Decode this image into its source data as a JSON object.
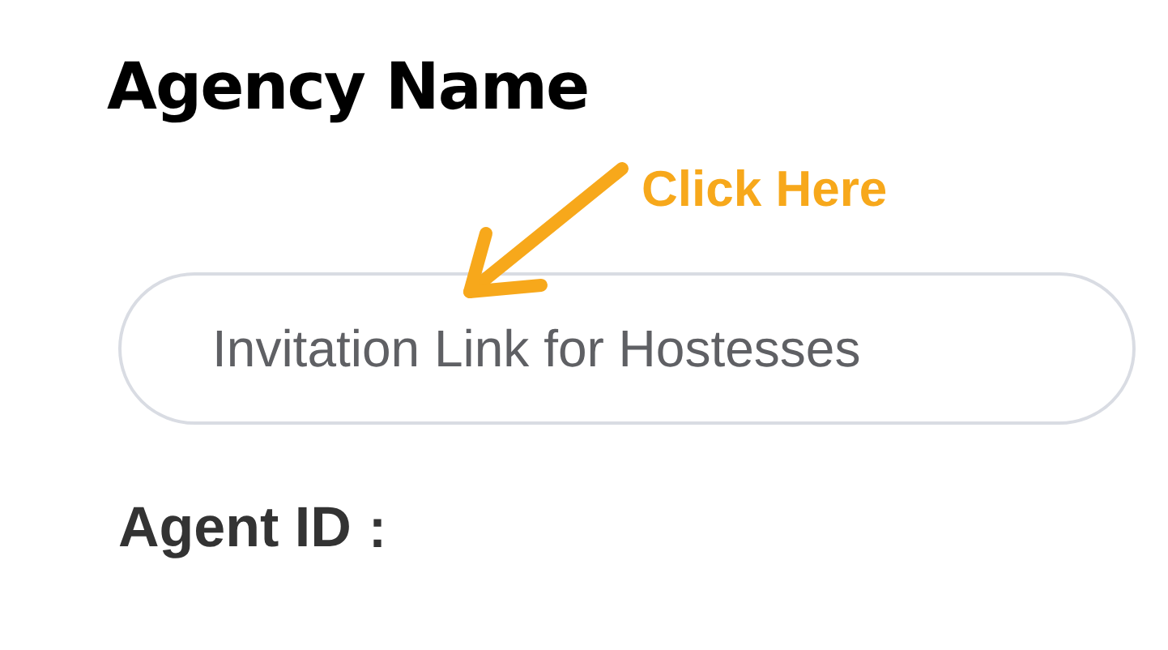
{
  "heading": "Agency Name",
  "callout": {
    "label": "Click Here"
  },
  "invite_button": {
    "label": "Invitation Link for Hostesses"
  },
  "agent_id": {
    "label": "Agent ID",
    "separator": "："
  }
}
